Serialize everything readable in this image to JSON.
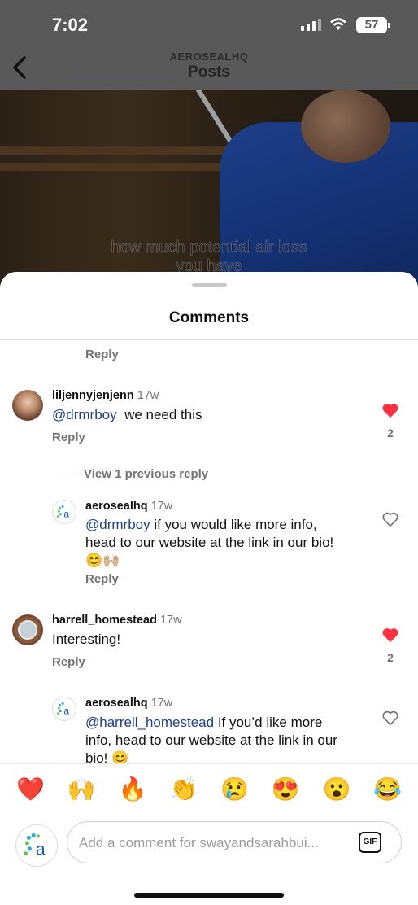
{
  "status": {
    "time": "7:02",
    "battery": "57"
  },
  "nav": {
    "account": "AEROSEALHQ",
    "title": "Posts"
  },
  "video": {
    "caption_line1": "how much potential air loss",
    "caption_line2": "you have"
  },
  "sheet": {
    "title": "Comments",
    "reply_label": "Reply"
  },
  "comments": [
    {
      "username": "liljennyjenjenn",
      "age": "17w",
      "mention": "@drmrboy",
      "text": "we need this",
      "liked": true,
      "like_count": "2"
    },
    {
      "view_previous": "View 1 previous reply"
    },
    {
      "username": "aerosealhq",
      "age": "17w",
      "mention": "@drmrboy",
      "text_line1": "if you would like more info,",
      "text_line2": "head to our website at the link in our bio!",
      "text_line3": "😊🙌🏼",
      "liked": false
    },
    {
      "username": "harrell_homestead",
      "age": "17w",
      "text": "Interesting!",
      "liked": true,
      "like_count": "2"
    },
    {
      "username": "aerosealhq",
      "age": "17w",
      "mention": "@harrell_homestead",
      "text_line1": "If you’d like more",
      "text_line2": "info, head to our website at the link in our",
      "text_line3": "bio! 😊",
      "liked": false
    }
  ],
  "reactions": [
    "❤️",
    "🙌",
    "🔥",
    "👏",
    "😢",
    "😍",
    "😮",
    "😂"
  ],
  "composer": {
    "placeholder": "Add a comment for swayandsarahbui...",
    "gif_label": "GIF"
  },
  "colors": {
    "mention": "#1d3f8a",
    "heart": "#ff3040",
    "muted": "#737373"
  }
}
